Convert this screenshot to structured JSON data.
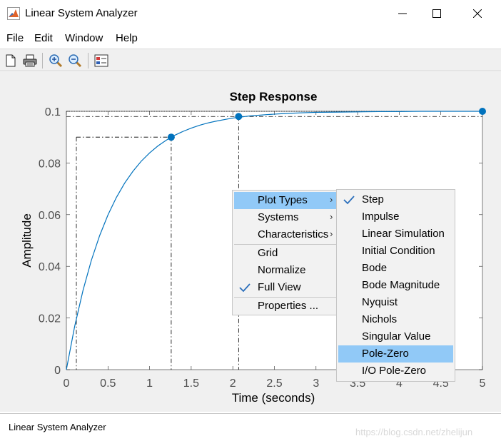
{
  "window": {
    "title": "Linear System Analyzer",
    "controls": {
      "minimize": "minimize-icon",
      "maximize": "maximize-icon",
      "close": "close-icon"
    }
  },
  "menubar": [
    "File",
    "Edit",
    "Window",
    "Help"
  ],
  "toolbar": {
    "icons": [
      "new-document-icon",
      "print-icon",
      "zoom-in-icon",
      "zoom-out-icon",
      "plot-configurations-icon"
    ]
  },
  "chart_data": {
    "type": "line",
    "title": "Step Response",
    "xlabel": "Time (seconds)",
    "ylabel": "Amplitude",
    "xlim": [
      0,
      5
    ],
    "ylim": [
      0,
      0.1
    ],
    "xticks": [
      "0",
      "0.5",
      "1",
      "1.5",
      "2",
      "2.5",
      "3",
      "3.5",
      "4",
      "4.5",
      "5"
    ],
    "yticks": [
      "0",
      "0.02",
      "0.04",
      "0.06",
      "0.08",
      "0.1"
    ],
    "grid": false,
    "series": [
      {
        "x": [
          0,
          0.1,
          0.2,
          0.3,
          0.4,
          0.5,
          0.6,
          0.7,
          0.8,
          0.9,
          1.0,
          1.1,
          1.2,
          1.3,
          1.4,
          1.5,
          1.6,
          1.7,
          1.8,
          1.9,
          2.0,
          2.2,
          2.4,
          2.6,
          2.8,
          3.0,
          3.25,
          3.5,
          3.75,
          4.0,
          4.25,
          4.5,
          4.75,
          5.0
        ],
        "y": [
          0,
          0.0168,
          0.0307,
          0.0423,
          0.0519,
          0.0599,
          0.0666,
          0.0722,
          0.0768,
          0.0807,
          0.0839,
          0.0866,
          0.0888,
          0.0907,
          0.0922,
          0.0935,
          0.0946,
          0.0955,
          0.0962,
          0.0968,
          0.0974,
          0.0982,
          0.0987,
          0.0991,
          0.0994,
          0.0996,
          0.0997,
          0.0998,
          0.0999,
          0.0999,
          0.1,
          0.1,
          0.1,
          0.1
        ]
      }
    ],
    "characteristic_points": [
      {
        "x": 1.26,
        "y": 0.09
      },
      {
        "x": 2.07,
        "y": 0.098
      },
      {
        "x": 5.0,
        "y": 0.1
      }
    ],
    "rise_time_start": {
      "x": 0.12,
      "y": 0.01
    }
  },
  "context_menu": {
    "items": [
      {
        "label": "Plot Types",
        "submenu": true,
        "highlighted": true,
        "checked": false
      },
      {
        "label": "Systems",
        "submenu": true,
        "highlighted": false,
        "checked": false
      },
      {
        "label": "Characteristics",
        "submenu": true,
        "highlighted": false,
        "checked": false,
        "separator_after": true
      },
      {
        "label": "Grid",
        "submenu": false,
        "highlighted": false,
        "checked": false
      },
      {
        "label": "Normalize",
        "submenu": false,
        "highlighted": false,
        "checked": false
      },
      {
        "label": "Full View",
        "submenu": false,
        "highlighted": false,
        "checked": true,
        "separator_after": true
      },
      {
        "label": "Properties ...",
        "submenu": false,
        "highlighted": false,
        "checked": false
      }
    ]
  },
  "plot_types_submenu": {
    "items": [
      {
        "label": "Step",
        "checked": true,
        "highlighted": false
      },
      {
        "label": "Impulse",
        "checked": false,
        "highlighted": false
      },
      {
        "label": "Linear Simulation",
        "checked": false,
        "highlighted": false
      },
      {
        "label": "Initial Condition",
        "checked": false,
        "highlighted": false
      },
      {
        "label": "Bode",
        "checked": false,
        "highlighted": false
      },
      {
        "label": "Bode Magnitude",
        "checked": false,
        "highlighted": false
      },
      {
        "label": "Nyquist",
        "checked": false,
        "highlighted": false
      },
      {
        "label": "Nichols",
        "checked": false,
        "highlighted": false
      },
      {
        "label": "Singular Value",
        "checked": false,
        "highlighted": false
      },
      {
        "label": "Pole-Zero",
        "checked": false,
        "highlighted": true
      },
      {
        "label": "I/O Pole-Zero",
        "checked": false,
        "highlighted": false
      }
    ]
  },
  "statusbar": {
    "text": "Linear System Analyzer"
  },
  "watermark": "https://blog.csdn.net/zhelijun",
  "colors": {
    "line": "#0072bd",
    "highlight": "#91c9f7",
    "check": "#2a6ebb"
  }
}
